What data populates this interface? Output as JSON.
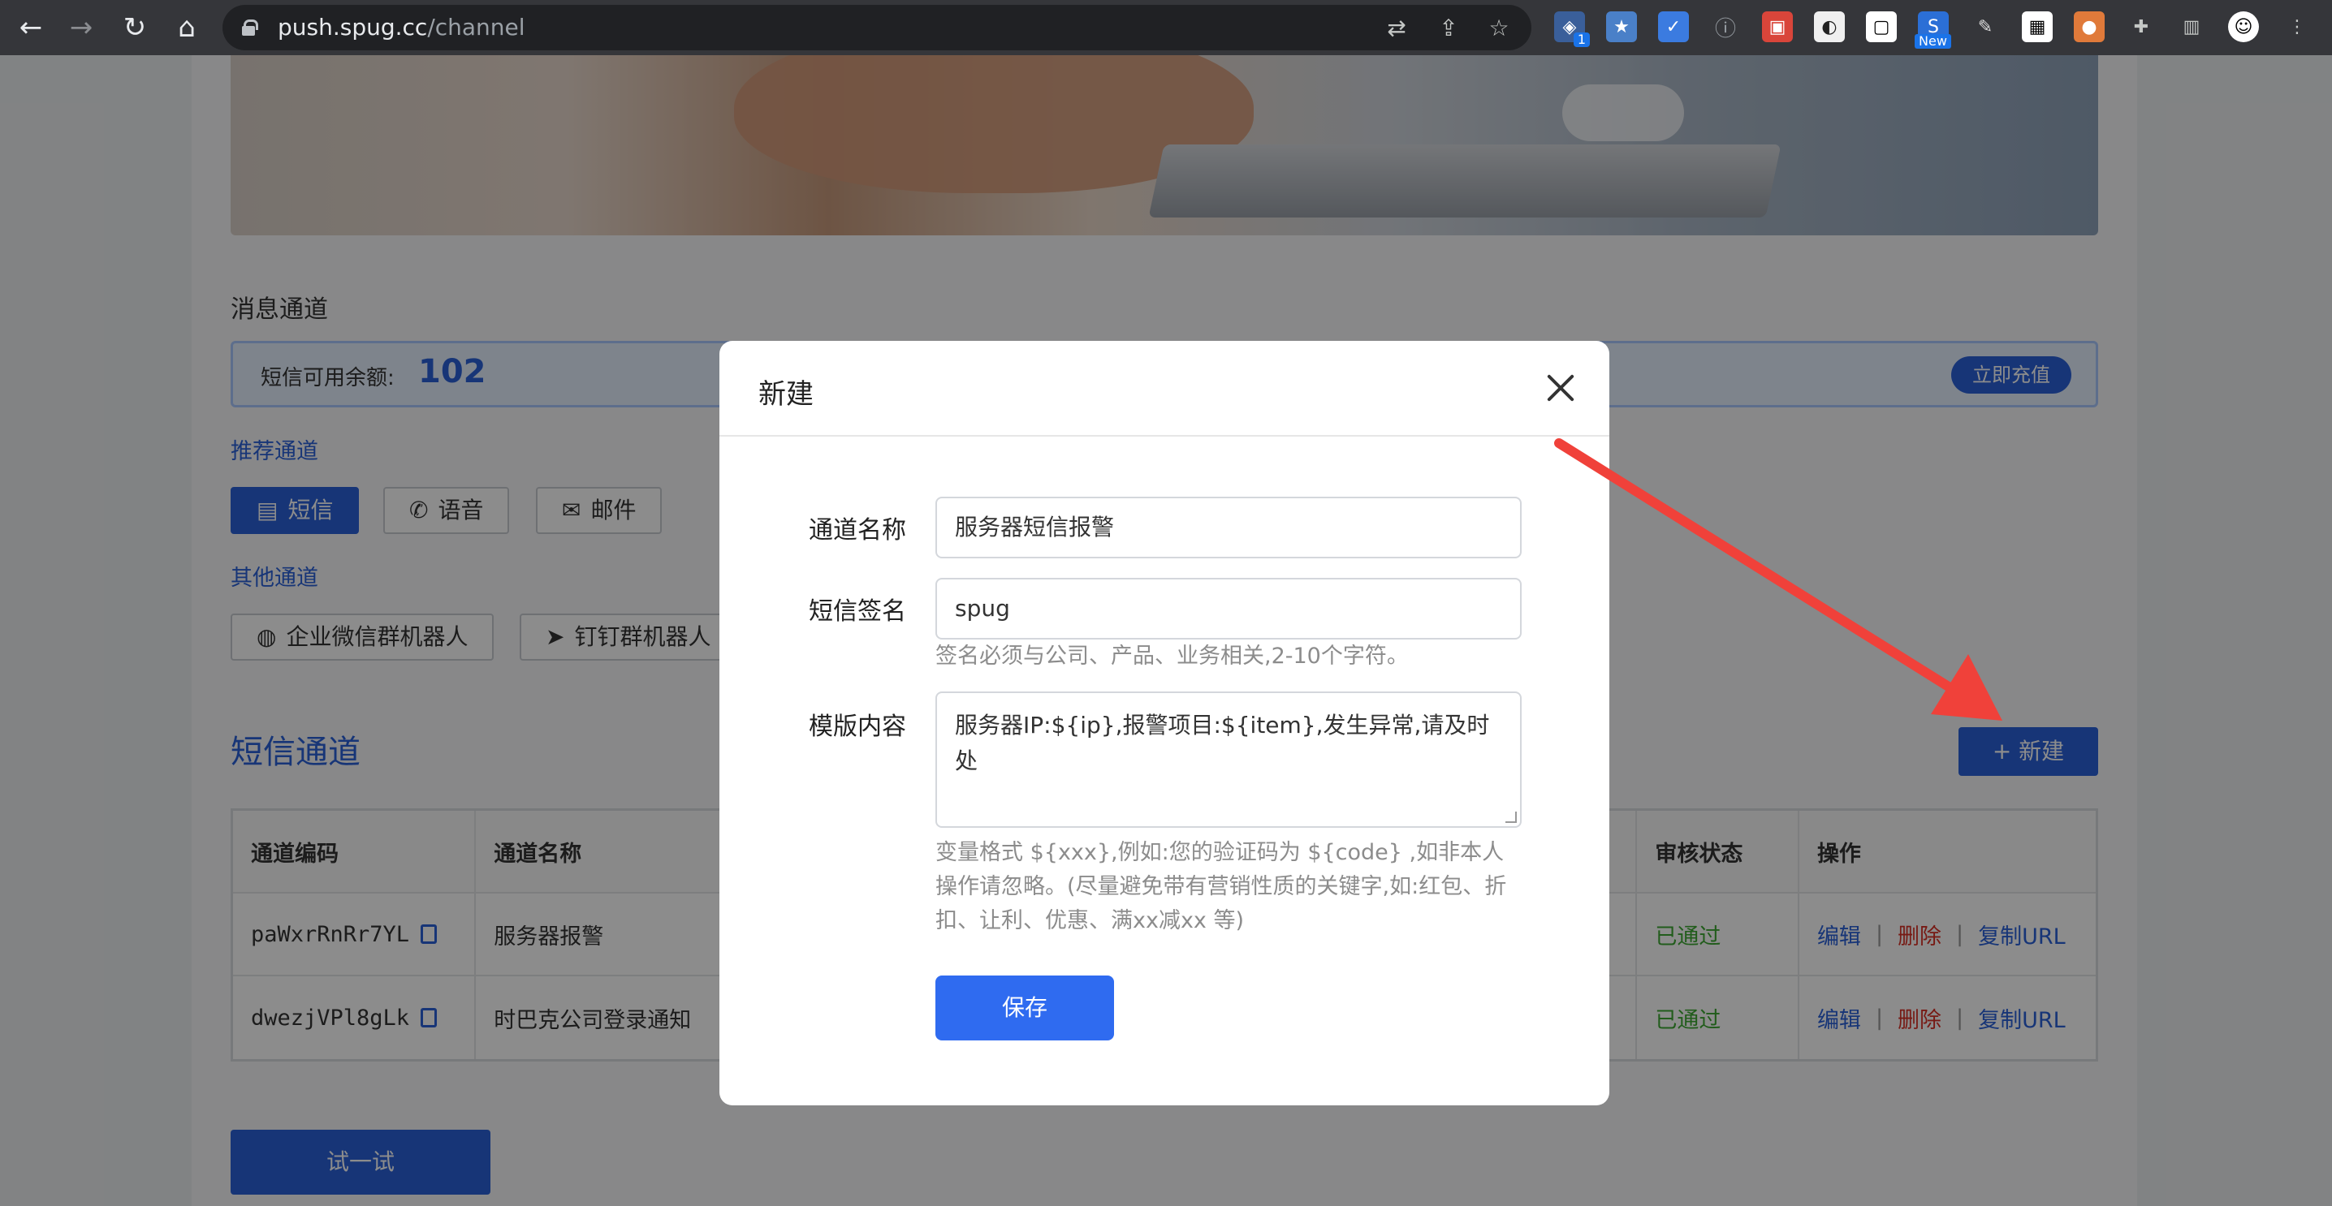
{
  "browser": {
    "url_host": "push.spug.cc",
    "url_path": "/channel",
    "ext_badge_count": "1",
    "ext_new_label": "New"
  },
  "page": {
    "section_title": "消息通道",
    "balance_label": "短信可用余额:",
    "balance_value": "102",
    "recharge_label": "立即充值",
    "recommended_label": "推荐通道",
    "recommended_channels": [
      "短信",
      "语音",
      "邮件"
    ],
    "other_label": "其他通道",
    "other_channels": [
      "企业微信群机器人",
      "钉钉群机器人"
    ],
    "sms_channel_title": "短信通道",
    "new_button_label": "+ 新建",
    "try_button_label": "试一试",
    "table": {
      "headers": [
        "通道编码",
        "通道名称",
        "审核状态",
        "操作"
      ],
      "rows": [
        {
          "code": "paWxrRnRr7YL",
          "name": "服务器报警",
          "status": "已通过"
        },
        {
          "code": "dwezjVPl8gLk",
          "name": "时巴克公司登录通知",
          "status": "已通过"
        }
      ],
      "actions": {
        "edit": "编辑",
        "delete": "删除",
        "copy_url": "复制URL",
        "separator": "|"
      }
    }
  },
  "modal": {
    "title": "新建",
    "fields": {
      "name_label": "通道名称",
      "name_value": "服务器短信报警",
      "sign_label": "短信签名",
      "sign_value": "spug",
      "sign_help": "签名必须与公司、产品、业务相关,2-10个字符。",
      "template_label": "模版内容",
      "template_value": "服务器IP:${ip},报警项目:${item},发生异常,请及时处",
      "template_help": "变量格式 ${xxx},例如:您的验证码为 ${code} ,如非本人操作请忽略。(尽量避免带有营销性质的关键字,如:红包、折扣、让利、优惠、满xx减xx 等)"
    },
    "save_label": "保存"
  },
  "colors": {
    "primary": "#2b62d9",
    "save": "#2f6bf0",
    "success": "#3da832",
    "danger": "#d93026",
    "arrow": "#f0413a"
  }
}
